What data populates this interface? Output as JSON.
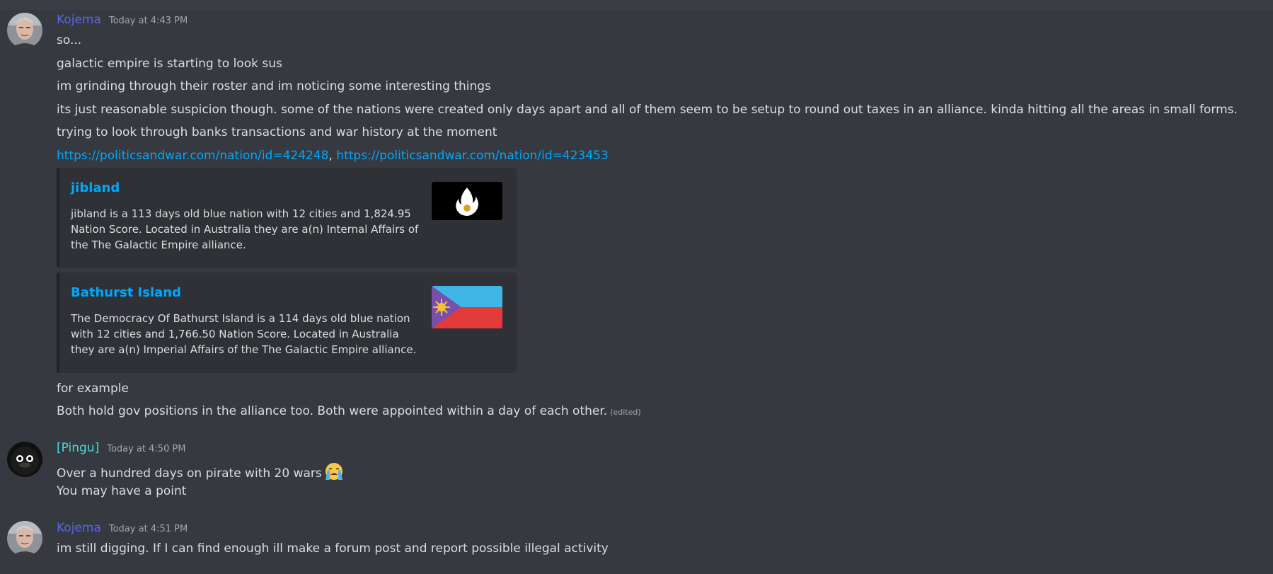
{
  "messages": [
    {
      "author": "Kojema",
      "timestamp": "Today at 4:43 PM",
      "avatar_icon": "man-avatar-icon",
      "lines": [
        "so...",
        "galactic empire is starting to look sus",
        "im grinding through their roster and im noticing some interesting things",
        "its just reasonable suspicion though. some of the nations were created only days apart and all of them seem to be setup to round out taxes in an alliance. kinda hitting all the areas in small forms.",
        "trying to look through banks transactions and war history at the moment"
      ],
      "links": [
        "https://politicsandwar.com/nation/id=424248",
        "https://politicsandwar.com/nation/id=423453"
      ],
      "link_separator": ", ",
      "embeds": [
        {
          "title": "jibland",
          "description": "jibland is a 113 days old blue nation with 12 cities and 1,824.95 Nation Score. Located in Australia they are a(n) Internal Affairs of the The Galactic Empire alliance.",
          "thumbnail_icon": "flame-flag-icon"
        },
        {
          "title": "Bathurst Island",
          "description": "The Democracy Of Bathurst Island is a 114 days old blue nation with 12 cities and 1,766.50 Nation Score. Located in Australia they are a(n) Imperial Affairs of the The Galactic Empire alliance.",
          "thumbnail_icon": "sun-flag-icon"
        }
      ],
      "after_lines": [
        "for example",
        "Both hold gov positions in the alliance too. Both were appointed within a day of each other."
      ],
      "edited_label": "(edited)"
    },
    {
      "author": "[Pingu]",
      "timestamp": "Today at 4:50 PM",
      "avatar_icon": "penguin-avatar-icon",
      "lines": [
        "Over a hundred days on pirate with 20 wars",
        "You may have a point"
      ],
      "emoji_icon": "loudly-crying-face-icon"
    },
    {
      "author": "Kojema",
      "timestamp": "Today at 4:51 PM",
      "avatar_icon": "man-avatar-icon",
      "lines": [
        "im still digging. If I can find enough ill make a forum post and report possible illegal activity"
      ]
    }
  ],
  "colors": {
    "background": "#36393f",
    "text": "#dcddde",
    "link": "#00a8fc",
    "kojema_name": "#5865f2",
    "pingu_name": "#46ddd8",
    "embed_bg": "#2f3136",
    "timestamp": "#a3a6aa"
  }
}
